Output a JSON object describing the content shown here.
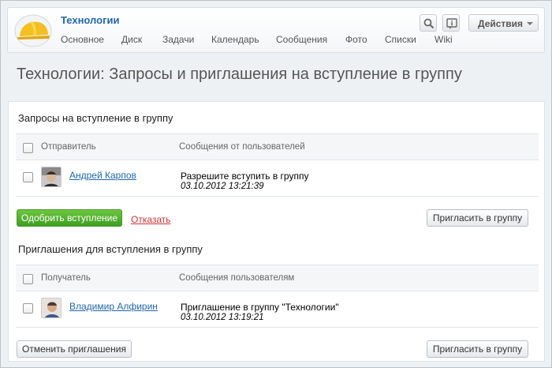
{
  "header": {
    "group_title": "Технологии",
    "nav": [
      "Основное",
      "Диск",
      "Задачи",
      "Календарь",
      "Сообщения",
      "Фото",
      "Списки",
      "Wiki"
    ],
    "actions_label": "Действия",
    "icons": [
      "search-icon",
      "info-icon",
      "chevron-down-icon"
    ]
  },
  "page": {
    "title": "Технологии: Запросы и приглашения на вступление в группу"
  },
  "requests": {
    "section_title": "Запросы на вступление в группу",
    "col_sender": "Отправитель",
    "col_messages": "Сообщения от пользователей",
    "rows": [
      {
        "name": "Андрей Карпов",
        "message": "Разрешите вступить в группу",
        "date": "03.10.2012 13:21:39"
      }
    ],
    "approve_label": "Одобрить вступление",
    "decline_label": "Отказать",
    "invite_label": "Пригласить в группу"
  },
  "invitations": {
    "section_title": "Приглашения для вступления в группу",
    "col_recipient": "Получатель",
    "col_messages": "Сообщения пользователям",
    "rows": [
      {
        "name": "Владимир Алфирин",
        "message": "Приглашение в группу \"Технологии\"",
        "date": "03.10.2012 13:19:21"
      }
    ],
    "cancel_label": "Отменить приглашения",
    "invite_label": "Пригласить в группу"
  },
  "colors": {
    "accent": "#2067b0",
    "approve": "#4caf2f",
    "decline": "#d23232"
  }
}
